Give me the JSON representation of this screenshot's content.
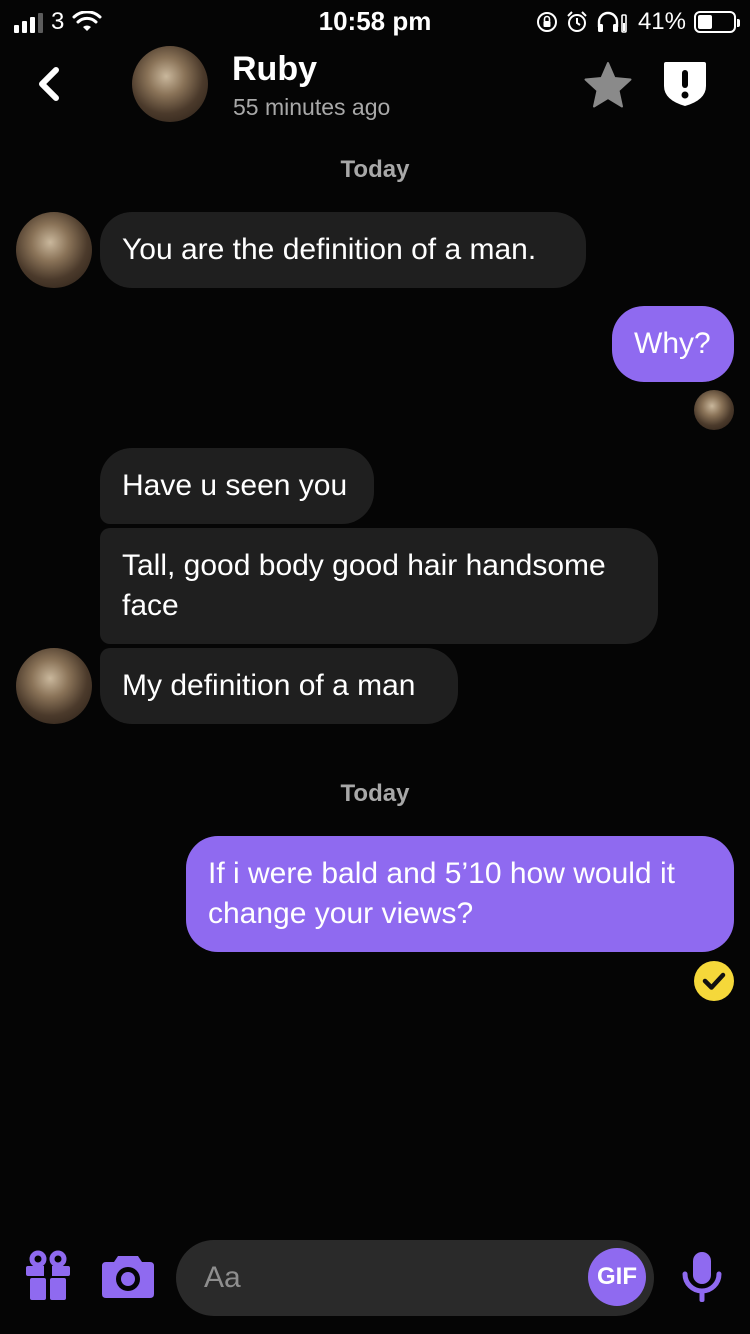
{
  "status_bar": {
    "carrier": "3",
    "time": "10:58 pm",
    "battery": "41%",
    "battery_level": 0.41,
    "icons": [
      "signal-icon",
      "wifi-icon",
      "rotation-lock-icon",
      "alarm-icon",
      "headphones-icon",
      "battery-icon"
    ]
  },
  "header": {
    "name": "Ruby",
    "last_seen": "55 minutes ago",
    "icons": [
      "back-chevron-icon",
      "star-icon",
      "report-icon"
    ]
  },
  "thread": {
    "day_1": "Today",
    "day_2": "Today",
    "messages": [
      {
        "from": "them",
        "text": "You are the definition of a man."
      },
      {
        "from": "me",
        "text": "Why?"
      },
      {
        "from": "them",
        "text": "Have u seen you"
      },
      {
        "from": "them",
        "text": "Tall, good body good hair handsome face"
      },
      {
        "from": "them",
        "text": "My definition of a man"
      },
      {
        "from": "me",
        "text": "If i were bald and 5’10 how would it change your views?"
      }
    ]
  },
  "composer": {
    "placeholder": "Aa",
    "gif_label": "GIF",
    "icons": [
      "gift-icon",
      "camera-icon",
      "microphone-icon"
    ]
  },
  "colors": {
    "accent": "#8f6af0",
    "incoming_bubble": "#1f1f1f",
    "background": "#050505",
    "read_receipt": "#f5d83a"
  }
}
